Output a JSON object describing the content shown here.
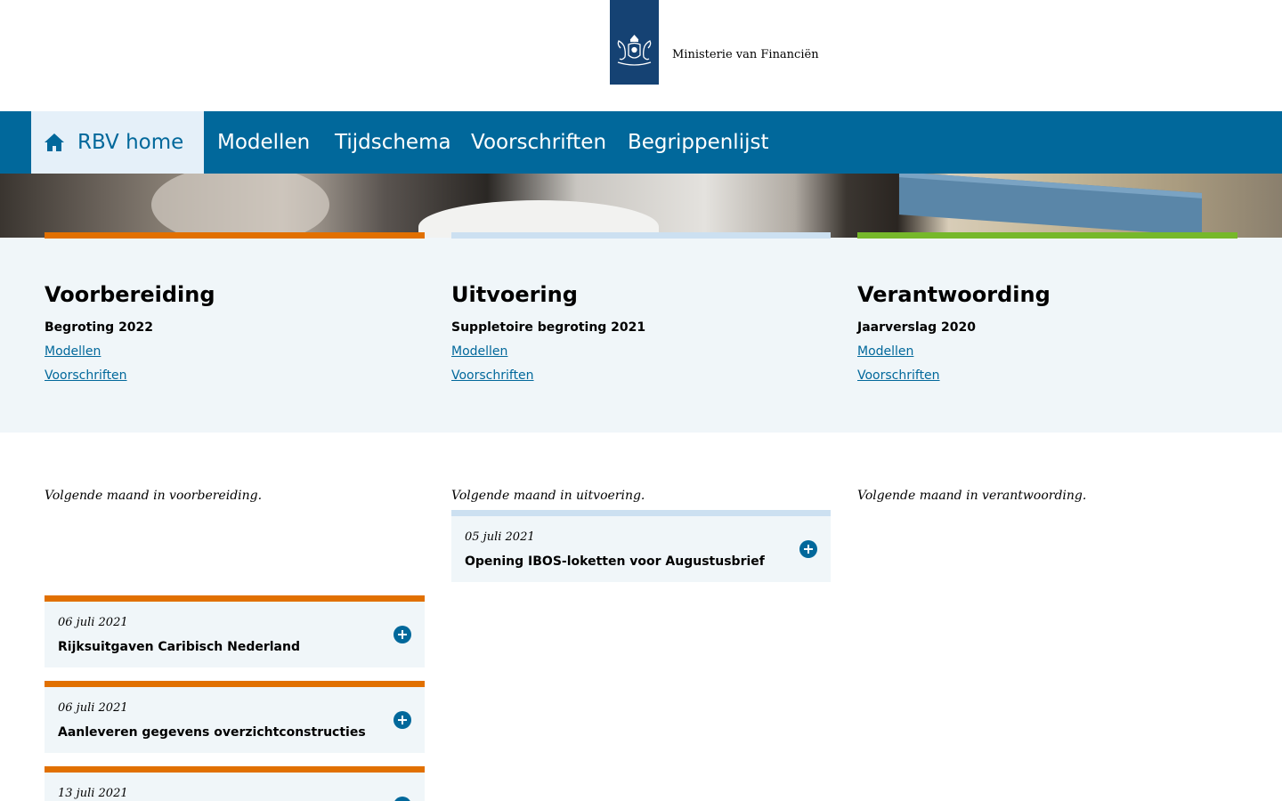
{
  "header": {
    "logo_icon": "rijksoverheid-coat-of-arms-icon",
    "ministry": "Ministerie van Financiën"
  },
  "nav": {
    "home_icon": "home-icon",
    "home": "RBV home",
    "items": [
      "Modellen",
      "Tijdschema",
      "Voorschriften",
      "Begrippenlijst"
    ]
  },
  "phases": [
    {
      "title": "Voorbereiding",
      "subtitle": "Begroting 2022",
      "links": [
        "Modellen",
        "Voorschriften"
      ],
      "accent": "#e17000"
    },
    {
      "title": "Uitvoering",
      "subtitle": "Suppletoire begroting 2021",
      "links": [
        "Modellen",
        "Voorschriften"
      ],
      "accent": "#cce0f1"
    },
    {
      "title": "Verantwoording",
      "subtitle": "Jaarverslag 2020",
      "links": [
        "Modellen",
        "Voorschriften"
      ],
      "accent": "#76b82a"
    }
  ],
  "monthly": {
    "intro_voorbereiding": "Volgende maand in voorbereiding.",
    "intro_uitvoering": "Volgende maand in uitvoering.",
    "intro_verantwoording": "Volgende maand in verantwoording.",
    "voorbereiding_items": [
      {
        "date": "06 juli 2021",
        "title": "Rijksuitgaven Caribisch Nederland"
      },
      {
        "date": "06 juli 2021",
        "title": "Aanleveren gegevens overzichtconstructies"
      },
      {
        "date": "13 juli 2021",
        "title": ""
      }
    ],
    "uitvoering_items": [
      {
        "date": "05 juli 2021",
        "title": "Opening IBOS-loketten voor Augustusbrief"
      }
    ]
  },
  "colors": {
    "nav_bg": "#01689b",
    "logo_bg": "#154273",
    "voorbereiding": "#e17000",
    "uitvoering": "#cce0f1",
    "verantwoording": "#76b82a",
    "panel_bg": "#f0f6f9"
  }
}
